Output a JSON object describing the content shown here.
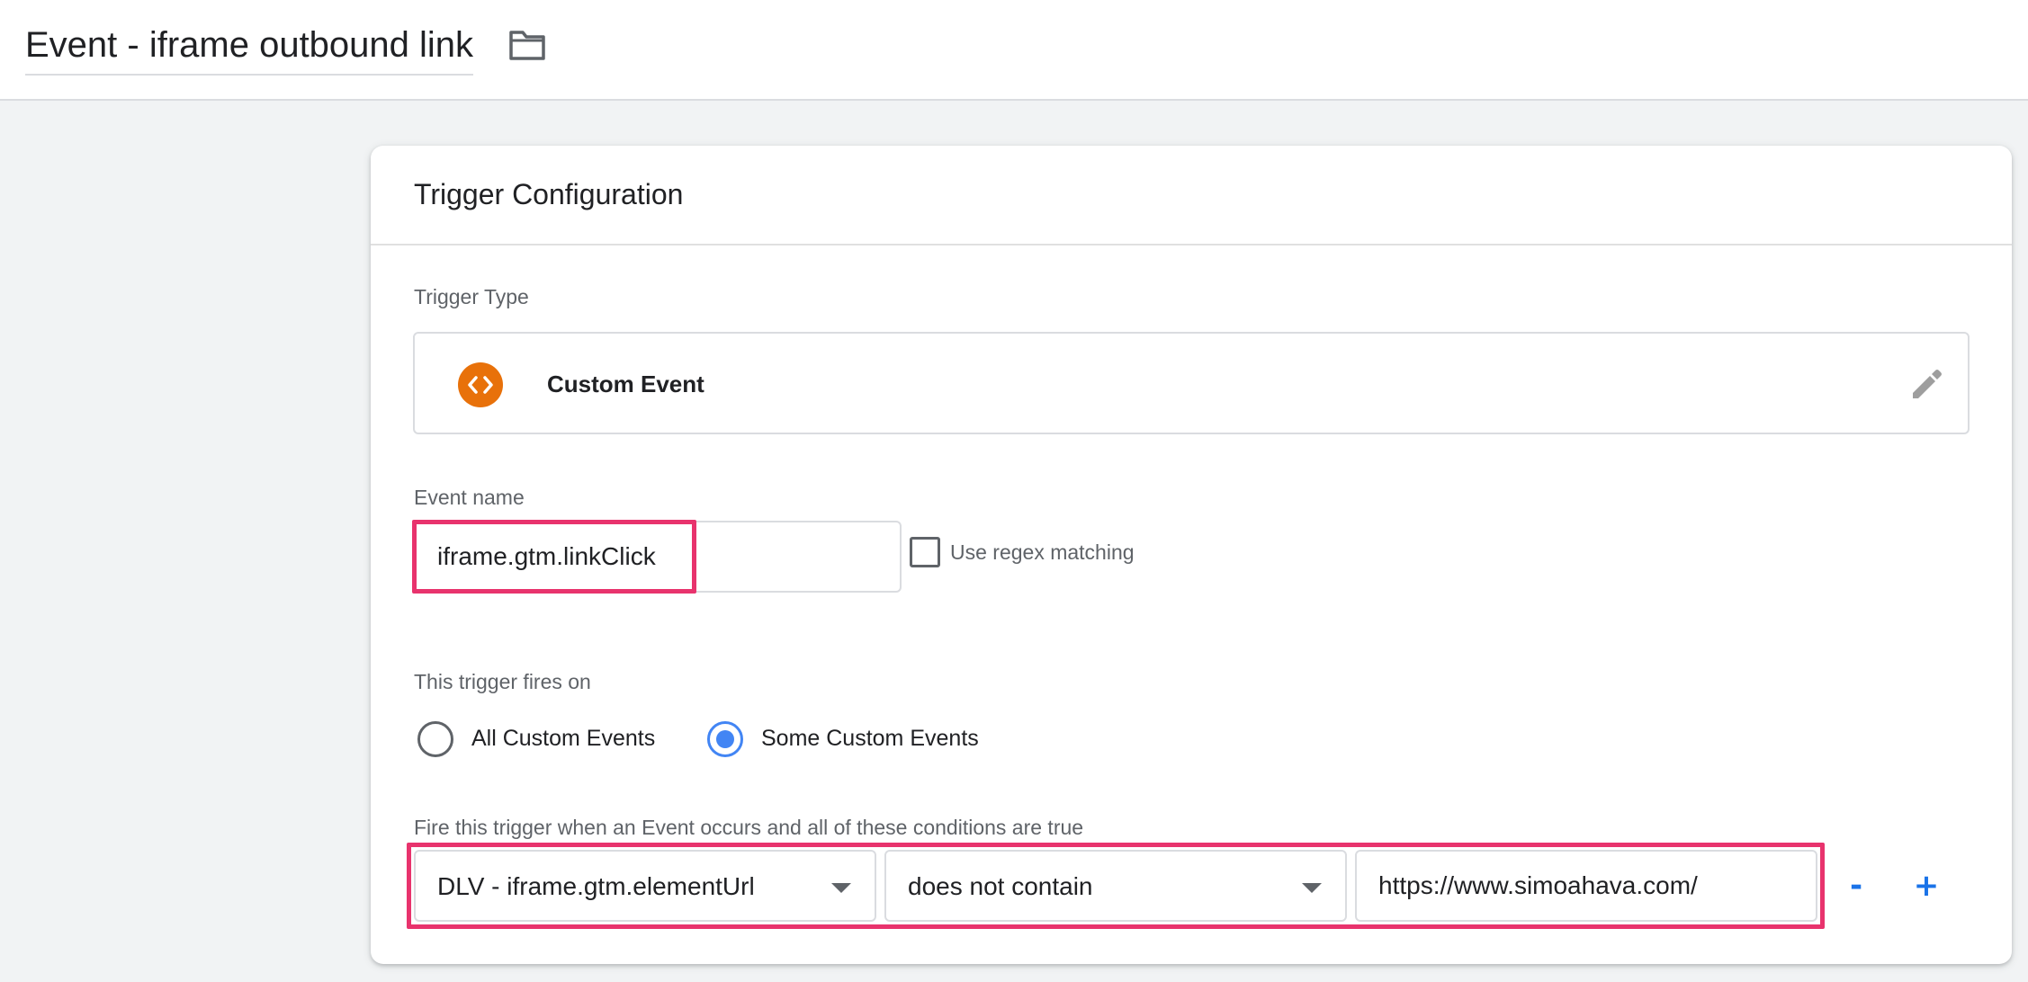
{
  "header": {
    "title": "Event - iframe outbound link",
    "folder_icon": "folder-icon"
  },
  "card": {
    "title": "Trigger Configuration",
    "trigger_type": {
      "label": "Trigger Type",
      "name": "Custom Event",
      "icon": "code-brackets-icon",
      "icon_color": "#e8710a",
      "edit_icon": "pencil-icon"
    },
    "event_name": {
      "label": "Event name",
      "value": "iframe.gtm.linkClick",
      "regex_label": "Use regex matching",
      "regex_checked": false
    },
    "fires_on": {
      "label": "This trigger fires on",
      "options": [
        {
          "label": "All Custom Events",
          "selected": false
        },
        {
          "label": "Some Custom Events",
          "selected": true
        }
      ]
    },
    "condition": {
      "label": "Fire this trigger when an Event occurs and all of these conditions are true",
      "variable": "DLV - iframe.gtm.elementUrl",
      "operator": "does not contain",
      "value": "https://www.simoahava.com/",
      "remove_label": "-",
      "add_label": "+"
    }
  },
  "colors": {
    "highlight": "#e8336d",
    "accent": "#1a73e8",
    "radio_selected": "#4285f4"
  }
}
